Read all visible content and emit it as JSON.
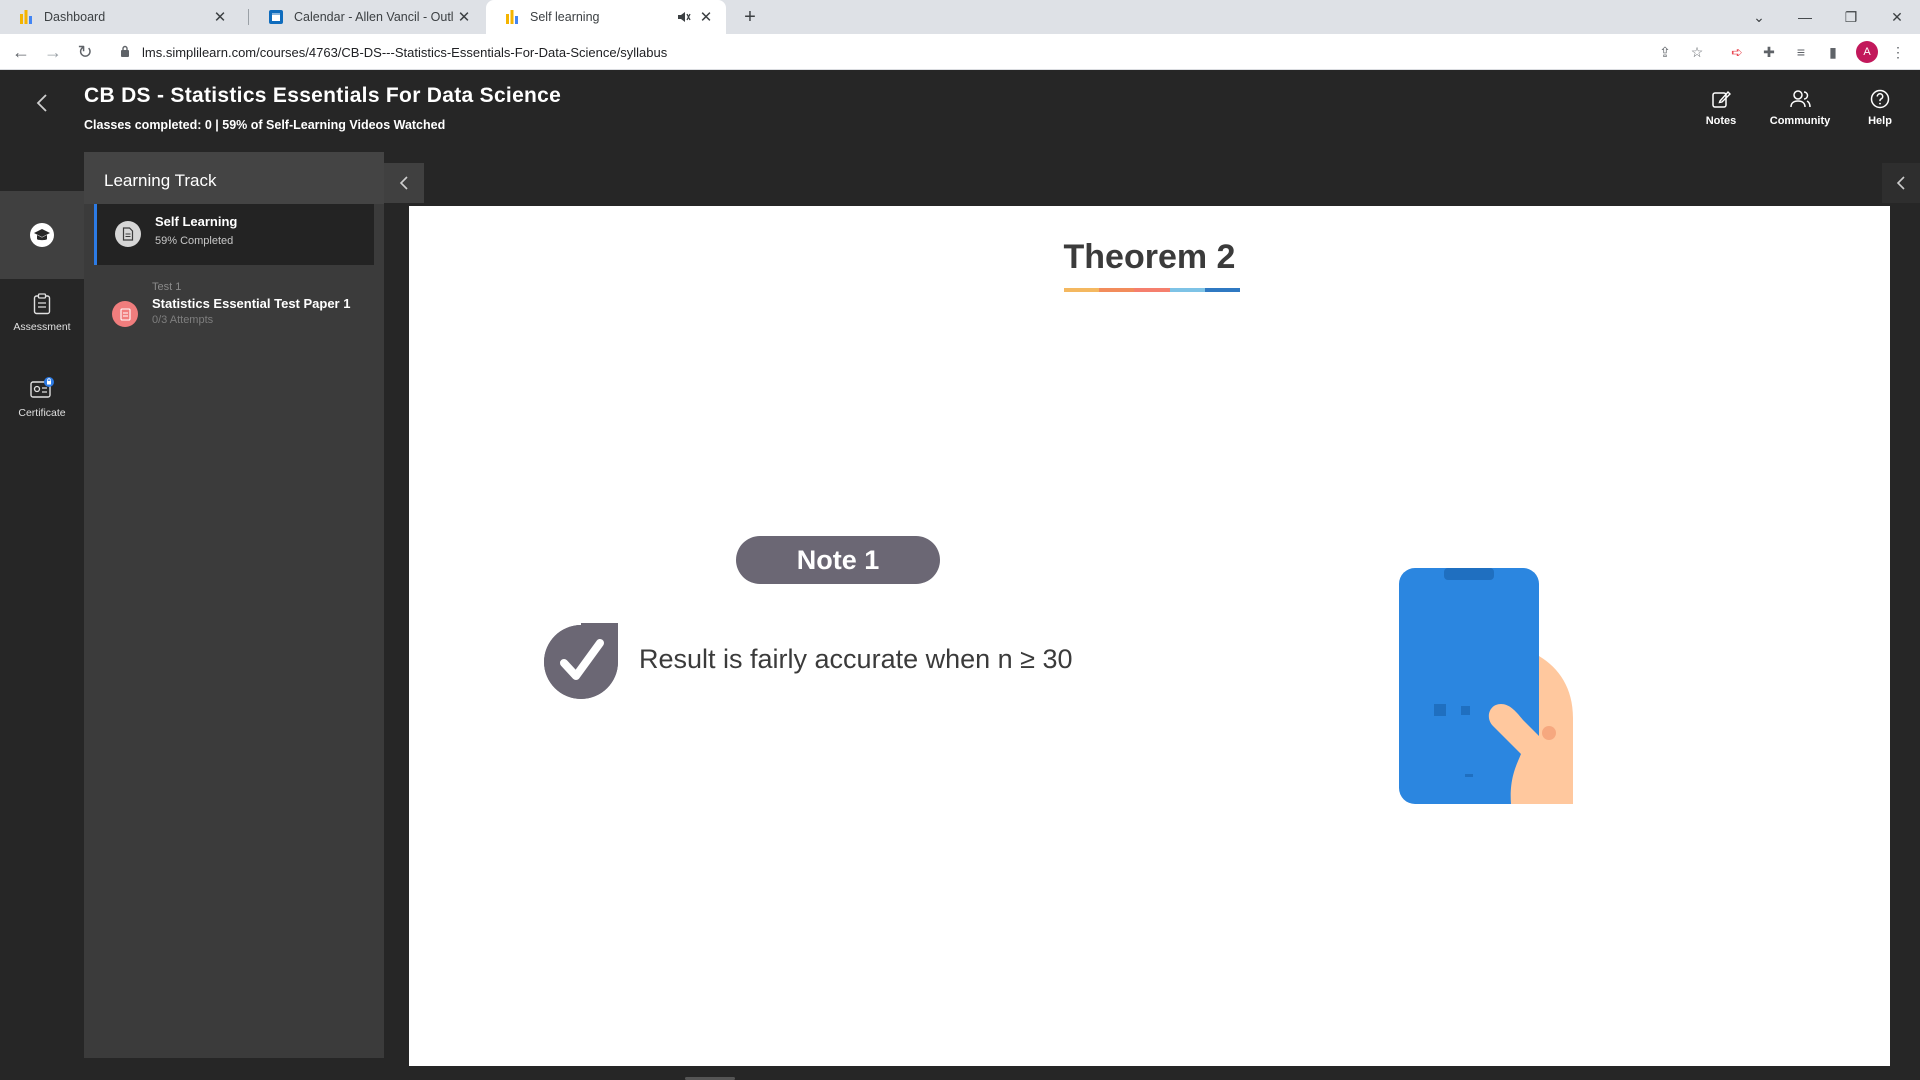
{
  "browser": {
    "tabs": [
      {
        "title": "Dashboard",
        "active": false
      },
      {
        "title": "Calendar - Allen Vancil - Outlook",
        "active": false
      },
      {
        "title": "Self learning",
        "active": true
      }
    ],
    "url": "lms.simplilearn.com/courses/4763/CB-DS---Statistics-Essentials-For-Data-Science/syllabus",
    "profile_initial": "A"
  },
  "header": {
    "course_title": "CB DS - Statistics Essentials For Data Science",
    "progress_line": "Classes completed: 0 | 59% of Self-Learning Videos Watched",
    "actions": [
      {
        "label": "Notes",
        "icon": "notes-icon"
      },
      {
        "label": "Community",
        "icon": "community-icon"
      },
      {
        "label": "Help",
        "icon": "help-icon"
      }
    ]
  },
  "rail": {
    "items": [
      {
        "label": "",
        "icon": "graduation-cap-icon",
        "active": true
      },
      {
        "label": "Assessment",
        "icon": "clipboard-icon",
        "active": false
      },
      {
        "label": "Certificate",
        "icon": "certificate-icon",
        "active": false
      }
    ]
  },
  "track": {
    "title": "Learning Track",
    "items": [
      {
        "kicker": "",
        "name": "Self Learning",
        "meta": "59% Completed",
        "active": true
      },
      {
        "kicker": "Test 1",
        "name": "Statistics Essential Test Paper 1",
        "meta": "0/3 Attempts",
        "active": false
      }
    ]
  },
  "slide": {
    "title": "Theorem 2",
    "underline_colors": [
      "#f4b860",
      "#f28c5b",
      "#f57f6d",
      "#7ec3e6",
      "#2f79c2"
    ],
    "note_label": "Note 1",
    "statement": "Result is fairly accurate when n ≥ 30",
    "colors": {
      "pill": "#6b6774",
      "phone": "#2b86e0",
      "hand": "#ffc89e"
    }
  }
}
